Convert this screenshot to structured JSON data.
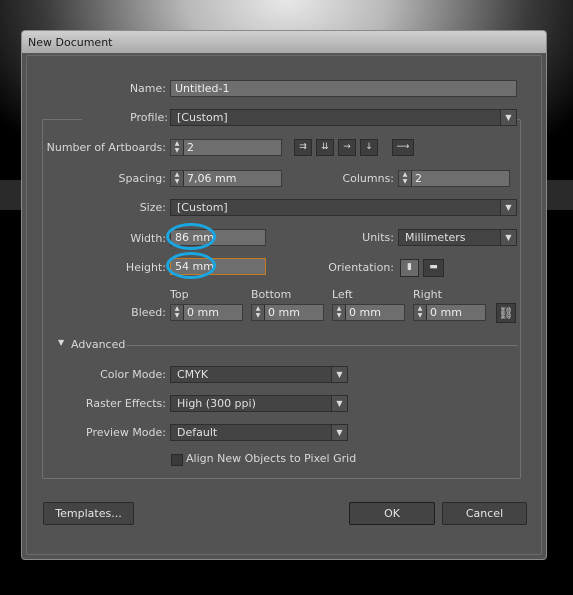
{
  "window": {
    "title": "New Document"
  },
  "fields": {
    "name": {
      "label": "Name:",
      "value": "Untitled-1"
    },
    "profile": {
      "label": "Profile:",
      "value": "[Custom]"
    },
    "artboards": {
      "label": "Number of Artboards:",
      "value": "2"
    },
    "spacing": {
      "label": "Spacing:",
      "value": "7,06 mm"
    },
    "columns": {
      "label": "Columns:",
      "value": "2"
    },
    "size": {
      "label": "Size:",
      "value": "[Custom]"
    },
    "width": {
      "label": "Width:",
      "value": "86 mm"
    },
    "height": {
      "label": "Height:",
      "value": "54 mm"
    },
    "units": {
      "label": "Units:",
      "value": "Millimeters"
    },
    "orientation": {
      "label": "Orientation:"
    },
    "bleed": {
      "label": "Bleed:",
      "top_label": "Top",
      "bottom_label": "Bottom",
      "left_label": "Left",
      "right_label": "Right",
      "top": "0 mm",
      "bottom": "0 mm",
      "left": "0 mm",
      "right": "0 mm"
    }
  },
  "artboard_icons": [
    "grid-by-row-icon",
    "grid-by-column-icon",
    "arrange-by-row-icon",
    "arrange-by-column-icon",
    "right-to-left-icon"
  ],
  "advanced": {
    "label": "Advanced",
    "color_mode": {
      "label": "Color Mode:",
      "value": "CMYK"
    },
    "raster_effects": {
      "label": "Raster Effects:",
      "value": "High (300 ppi)"
    },
    "preview_mode": {
      "label": "Preview Mode:",
      "value": "Default"
    },
    "align_pixel_grid": {
      "label": "Align New Objects to Pixel Grid",
      "checked": false
    }
  },
  "buttons": {
    "templates": "Templates...",
    "ok": "OK",
    "cancel": "Cancel"
  },
  "colors": {
    "dialog_bg": "#535353",
    "highlight_ring": "#1aa6e0",
    "focus_border": "#c47a23"
  }
}
